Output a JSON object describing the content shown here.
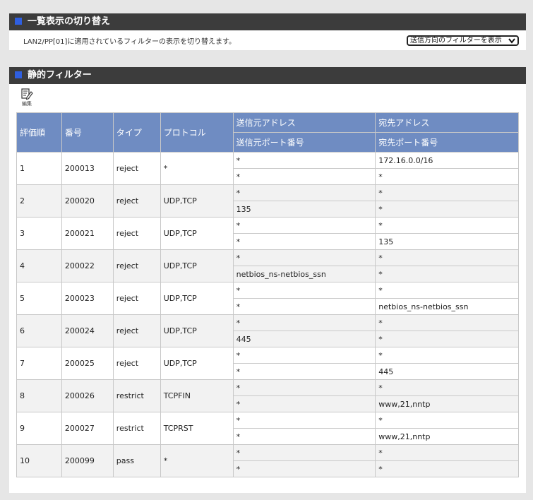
{
  "section1": {
    "title": "一覧表示の切り替え",
    "description": "LAN2/PP[01]に適用されているフィルターの表示を切り替えます。",
    "select_value": "送信方向のフィルターを表示"
  },
  "section2": {
    "title": "静的フィルター",
    "edit_label": "編集",
    "headers": {
      "order": "評価順",
      "number": "番号",
      "type": "タイプ",
      "protocol": "プロトコル",
      "src_addr": "送信元アドレス",
      "dst_addr": "宛先アドレス",
      "src_port": "送信元ポート番号",
      "dst_port": "宛先ポート番号"
    },
    "rows": [
      {
        "order": "1",
        "number": "200013",
        "type": "reject",
        "protocol": "*",
        "src_addr": "*",
        "dst_addr": "172.16.0.0/16",
        "src_port": "*",
        "dst_port": "*"
      },
      {
        "order": "2",
        "number": "200020",
        "type": "reject",
        "protocol": "UDP,TCP",
        "src_addr": "*",
        "dst_addr": "*",
        "src_port": "135",
        "dst_port": "*"
      },
      {
        "order": "3",
        "number": "200021",
        "type": "reject",
        "protocol": "UDP,TCP",
        "src_addr": "*",
        "dst_addr": "*",
        "src_port": "*",
        "dst_port": "135"
      },
      {
        "order": "4",
        "number": "200022",
        "type": "reject",
        "protocol": "UDP,TCP",
        "src_addr": "*",
        "dst_addr": "*",
        "src_port": "netbios_ns-netbios_ssn",
        "dst_port": "*"
      },
      {
        "order": "5",
        "number": "200023",
        "type": "reject",
        "protocol": "UDP,TCP",
        "src_addr": "*",
        "dst_addr": "*",
        "src_port": "*",
        "dst_port": "netbios_ns-netbios_ssn"
      },
      {
        "order": "6",
        "number": "200024",
        "type": "reject",
        "protocol": "UDP,TCP",
        "src_addr": "*",
        "dst_addr": "*",
        "src_port": "445",
        "dst_port": "*"
      },
      {
        "order": "7",
        "number": "200025",
        "type": "reject",
        "protocol": "UDP,TCP",
        "src_addr": "*",
        "dst_addr": "*",
        "src_port": "*",
        "dst_port": "445"
      },
      {
        "order": "8",
        "number": "200026",
        "type": "restrict",
        "protocol": "TCPFIN",
        "src_addr": "*",
        "dst_addr": "*",
        "src_port": "*",
        "dst_port": "www,21,nntp"
      },
      {
        "order": "9",
        "number": "200027",
        "type": "restrict",
        "protocol": "TCPRST",
        "src_addr": "*",
        "dst_addr": "*",
        "src_port": "*",
        "dst_port": "www,21,nntp"
      },
      {
        "order": "10",
        "number": "200099",
        "type": "pass",
        "protocol": "*",
        "src_addr": "*",
        "dst_addr": "*",
        "src_port": "*",
        "dst_port": "*"
      }
    ]
  },
  "colors": {
    "header_bar": "#3c3c3c",
    "accent_square": "#2f5fe0",
    "table_header": "#6f8cc2"
  }
}
